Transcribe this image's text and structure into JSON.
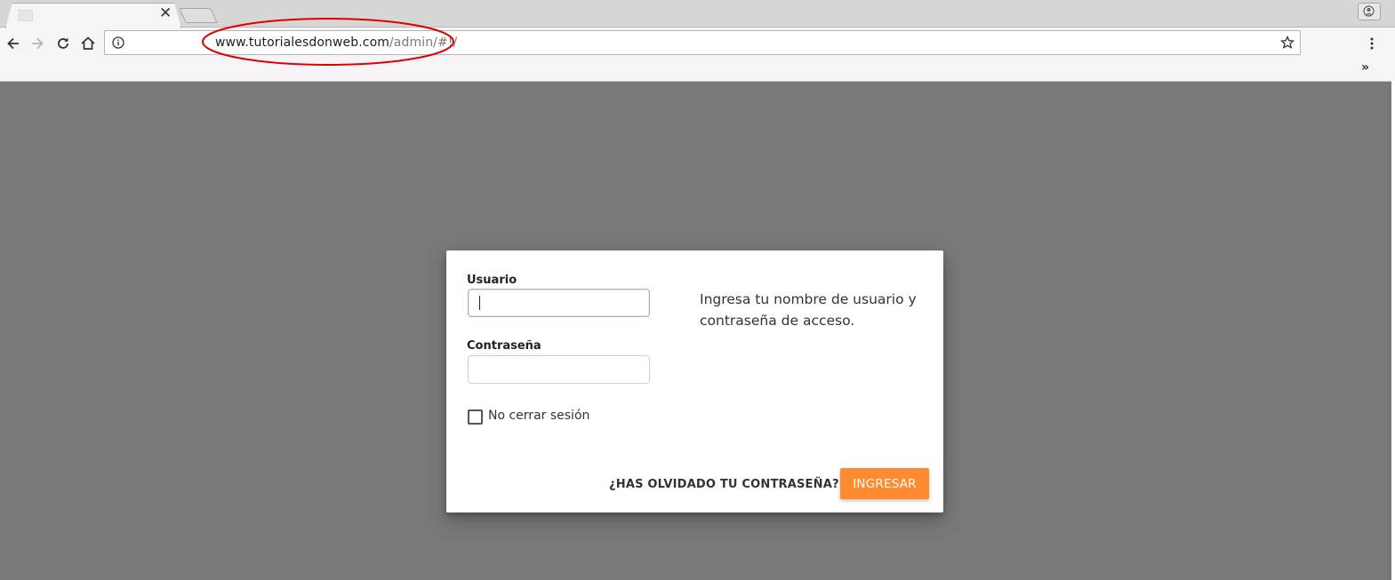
{
  "browser": {
    "tab_close_glyph": "✕",
    "address_bar": {
      "url_host": "www.tutorialesdonweb.com",
      "url_path": "/admin/#!/"
    },
    "extensions_chevron": "»",
    "annotation_color": "#e00000"
  },
  "login": {
    "username_label": "Usuario",
    "username_value": "",
    "password_label": "Contraseña",
    "password_value": "",
    "keep_session_label": "No cerrar sesión",
    "keep_session_checked": false,
    "help_text": "Ingresa tu nombre de usuario y contraseña de acceso.",
    "forgot_password_label": "¿HAS OLVIDADO TU CONTRASEÑA?",
    "submit_label": "INGRESAR",
    "accent_color": "#ff8a2f",
    "overlay_color": "#79777a"
  }
}
